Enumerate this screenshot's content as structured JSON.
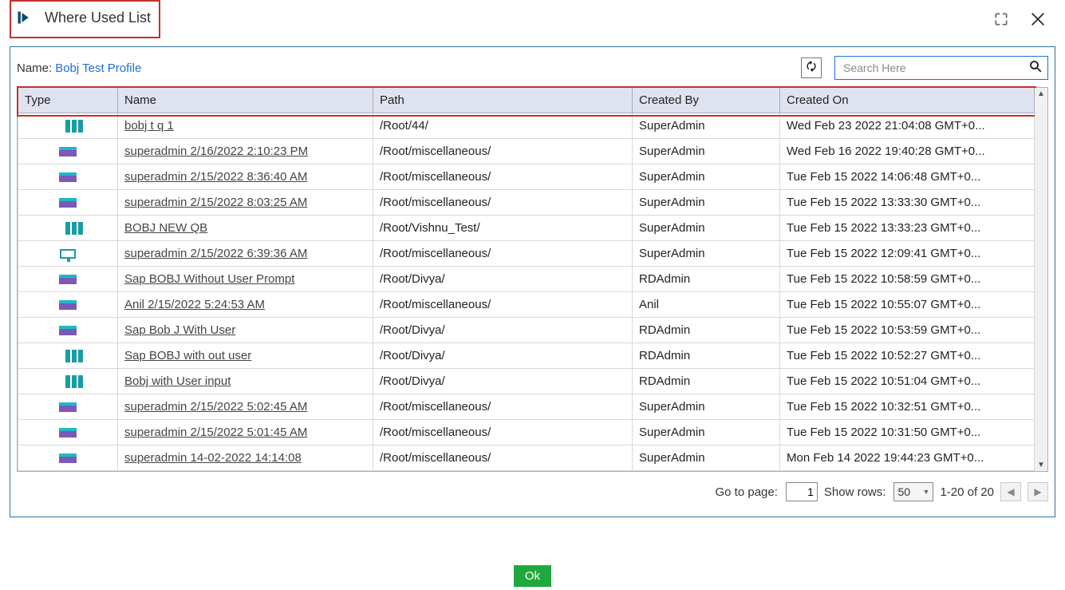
{
  "title": "Where Used List",
  "name_label": "Name:",
  "profile_name": "Bobj Test Profile",
  "search": {
    "placeholder": "Search Here"
  },
  "columns": {
    "type": "Type",
    "name": "Name",
    "path": "Path",
    "created_by": "Created By",
    "created_on": "Created On"
  },
  "rows": [
    {
      "icon": "a",
      "name": "bobj t q 1",
      "path": "/Root/44/",
      "cby": "SuperAdmin",
      "con": "Wed Feb 23 2022 21:04:08 GMT+0..."
    },
    {
      "icon": "b",
      "name": "superadmin 2/16/2022 2:10:23 PM",
      "path": "/Root/miscellaneous/",
      "cby": "SuperAdmin",
      "con": "Wed Feb 16 2022 19:40:28 GMT+0..."
    },
    {
      "icon": "b",
      "name": "superadmin 2/15/2022 8:36:40 AM",
      "path": "/Root/miscellaneous/",
      "cby": "SuperAdmin",
      "con": "Tue Feb 15 2022 14:06:48 GMT+0..."
    },
    {
      "icon": "b",
      "name": "superadmin 2/15/2022 8:03:25 AM",
      "path": "/Root/miscellaneous/",
      "cby": "SuperAdmin",
      "con": "Tue Feb 15 2022 13:33:30 GMT+0..."
    },
    {
      "icon": "a",
      "name": "BOBJ NEW QB",
      "path": "/Root/Vishnu_Test/",
      "cby": "SuperAdmin",
      "con": "Tue Feb 15 2022 13:33:23 GMT+0..."
    },
    {
      "icon": "c",
      "name": "superadmin 2/15/2022 6:39:36 AM",
      "path": "/Root/miscellaneous/",
      "cby": "SuperAdmin",
      "con": "Tue Feb 15 2022 12:09:41 GMT+0..."
    },
    {
      "icon": "b",
      "name": "Sap BOBJ Without User Prompt",
      "path": "/Root/Divya/",
      "cby": "RDAdmin",
      "con": "Tue Feb 15 2022 10:58:59 GMT+0..."
    },
    {
      "icon": "b",
      "name": "Anil 2/15/2022 5:24:53 AM",
      "path": "/Root/miscellaneous/",
      "cby": "Anil",
      "con": "Tue Feb 15 2022 10:55:07 GMT+0..."
    },
    {
      "icon": "b",
      "name": "Sap Bob J With User",
      "path": "/Root/Divya/",
      "cby": "RDAdmin",
      "con": "Tue Feb 15 2022 10:53:59 GMT+0..."
    },
    {
      "icon": "a",
      "name": "Sap BOBJ with out user",
      "path": "/Root/Divya/",
      "cby": "RDAdmin",
      "con": "Tue Feb 15 2022 10:52:27 GMT+0..."
    },
    {
      "icon": "a",
      "name": "Bobj with User input",
      "path": "/Root/Divya/",
      "cby": "RDAdmin",
      "con": "Tue Feb 15 2022 10:51:04 GMT+0..."
    },
    {
      "icon": "b",
      "name": "superadmin 2/15/2022 5:02:45 AM",
      "path": "/Root/miscellaneous/",
      "cby": "SuperAdmin",
      "con": "Tue Feb 15 2022 10:32:51 GMT+0..."
    },
    {
      "icon": "b",
      "name": "superadmin 2/15/2022 5:01:45 AM",
      "path": "/Root/miscellaneous/",
      "cby": "SuperAdmin",
      "con": "Tue Feb 15 2022 10:31:50 GMT+0..."
    },
    {
      "icon": "b",
      "name": "superadmin 14-02-2022 14:14:08",
      "path": "/Root/miscellaneous/",
      "cby": "SuperAdmin",
      "con": "Mon Feb 14 2022 19:44:23 GMT+0..."
    }
  ],
  "footer": {
    "goto_label": "Go to page:",
    "page": "1",
    "showrows_label": "Show rows:",
    "rows_per_page": "50",
    "range": "1-20 of 20"
  },
  "ok_label": "Ok"
}
